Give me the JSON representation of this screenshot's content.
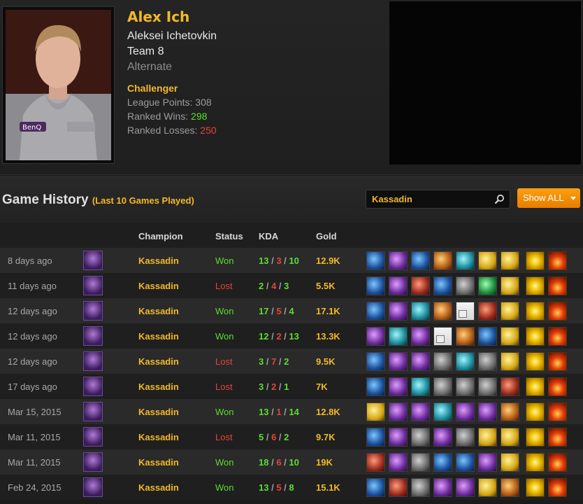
{
  "player": {
    "nickname": "Alex Ich",
    "real_name": "Aleksei Ichetovkin",
    "team": "Team 8",
    "role": "Alternate",
    "tier": "Challenger",
    "league_points_label": "League Points:",
    "league_points": "308",
    "ranked_wins_label": "Ranked Wins:",
    "ranked_wins": "298",
    "ranked_losses_label": "Ranked Losses:",
    "ranked_losses": "250"
  },
  "history": {
    "title": "Game History",
    "subtitle": "(Last 10 Games Played)",
    "search_value": "Kassadin",
    "filter_label": "Show ALL",
    "columns": [
      "Champion",
      "Status",
      "KDA",
      "Gold"
    ],
    "games": [
      {
        "date": "8 days ago",
        "champion": "Kassadin",
        "status": "Won",
        "kills": "13",
        "deaths": "3",
        "assists": "10",
        "gold": "12.9K",
        "items": [
          "blue",
          "purple",
          "blue",
          "orange",
          "teal",
          "gold",
          "gold"
        ]
      },
      {
        "date": "11 days ago",
        "champion": "Kassadin",
        "status": "Lost",
        "kills": "2",
        "deaths": "4",
        "assists": "3",
        "gold": "5.5K",
        "items": [
          "blue",
          "purple",
          "red",
          "blue",
          "grey",
          "green",
          "gold"
        ]
      },
      {
        "date": "12 days ago",
        "champion": "Kassadin",
        "status": "Won",
        "kills": "17",
        "deaths": "5",
        "assists": "4",
        "gold": "17.1K",
        "items": [
          "blue",
          "purple",
          "teal",
          "orange",
          "white",
          "red",
          "gold"
        ]
      },
      {
        "date": "12 days ago",
        "champion": "Kassadin",
        "status": "Won",
        "kills": "12",
        "deaths": "2",
        "assists": "13",
        "gold": "13.3K",
        "items": [
          "purple",
          "teal",
          "purple",
          "white",
          "orange",
          "blue",
          "gold"
        ]
      },
      {
        "date": "12 days ago",
        "champion": "Kassadin",
        "status": "Lost",
        "kills": "3",
        "deaths": "7",
        "assists": "2",
        "gold": "9.5K",
        "items": [
          "blue",
          "purple",
          "purple",
          "grey",
          "teal",
          "grey",
          "gold"
        ]
      },
      {
        "date": "17 days ago",
        "champion": "Kassadin",
        "status": "Lost",
        "kills": "3",
        "deaths": "2",
        "assists": "1",
        "gold": "7K",
        "items": [
          "blue",
          "purple",
          "teal",
          "grey",
          "grey",
          "grey",
          "red"
        ]
      },
      {
        "date": "Mar 15, 2015",
        "champion": "Kassadin",
        "status": "Won",
        "kills": "13",
        "deaths": "1",
        "assists": "14",
        "gold": "12.8K",
        "items": [
          "gold",
          "purple",
          "purple",
          "teal",
          "purple",
          "purple",
          "orange"
        ]
      },
      {
        "date": "Mar 11, 2015",
        "champion": "Kassadin",
        "status": "Lost",
        "kills": "5",
        "deaths": "6",
        "assists": "2",
        "gold": "9.7K",
        "items": [
          "blue",
          "purple",
          "grey",
          "purple",
          "grey",
          "gold",
          "gold"
        ]
      },
      {
        "date": "Mar 11, 2015",
        "champion": "Kassadin",
        "status": "Won",
        "kills": "18",
        "deaths": "6",
        "assists": "10",
        "gold": "19K",
        "items": [
          "red",
          "purple",
          "grey",
          "blue",
          "blue",
          "purple",
          "gold"
        ]
      },
      {
        "date": "Feb 24, 2015",
        "champion": "Kassadin",
        "status": "Won",
        "kills": "13",
        "deaths": "5",
        "assists": "8",
        "gold": "15.1K",
        "items": [
          "blue",
          "red",
          "grey",
          "purple",
          "purple",
          "gold",
          "orange"
        ]
      }
    ],
    "summoner_spells": [
      "flash",
      "ignite"
    ]
  },
  "colors": {
    "accent": "#f3b928",
    "win": "#5ade2e",
    "loss": "#e2453a",
    "button": "#f68b0a"
  }
}
